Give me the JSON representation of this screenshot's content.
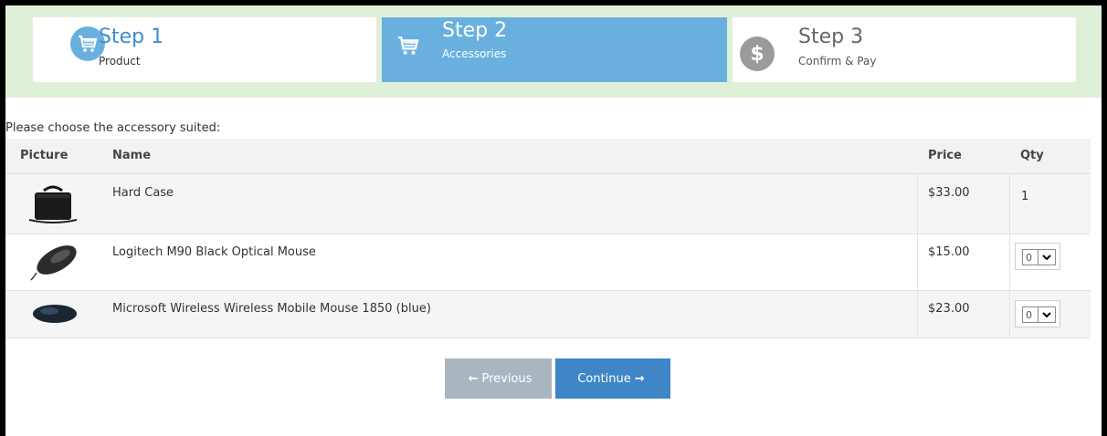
{
  "steps": [
    {
      "title": "Step 1",
      "subtitle": "Product",
      "icon": "cart-icon",
      "state": "done"
    },
    {
      "title": "Step 2",
      "subtitle": "Accessories",
      "icon": "cart-icon",
      "state": "active"
    },
    {
      "title": "Step 3",
      "subtitle": "Confirm & Pay",
      "icon": "dollar-icon",
      "state": "upcoming",
      "icon_glyph": "$"
    }
  ],
  "prompt": "Please choose the accessory suited:",
  "table": {
    "headers": {
      "picture": "Picture",
      "name": "Name",
      "price": "Price",
      "qty": "Qty"
    },
    "rows": [
      {
        "name": "Hard Case",
        "price": "$33.00",
        "qty": "1",
        "qty_editable": false,
        "picture": "laptop-case-image"
      },
      {
        "name": "Logitech M90 Black Optical Mouse",
        "price": "$15.00",
        "qty": "0",
        "qty_editable": true,
        "picture": "optical-mouse-image"
      },
      {
        "name": "Microsoft Wireless Wireless Mobile Mouse 1850 (blue)",
        "price": "$23.00",
        "qty": "0",
        "qty_editable": true,
        "picture": "wireless-mouse-image"
      }
    ]
  },
  "buttons": {
    "previous": {
      "label": "Previous",
      "icon": "arrow-left-icon"
    },
    "continue": {
      "label": "Continue",
      "icon": "arrow-right-icon"
    }
  },
  "colors": {
    "step_bar_bg": "#dff0d8",
    "active_step": "#6ab0de",
    "continue_button": "#3f86c6",
    "previous_button": "#a9b6bf"
  }
}
